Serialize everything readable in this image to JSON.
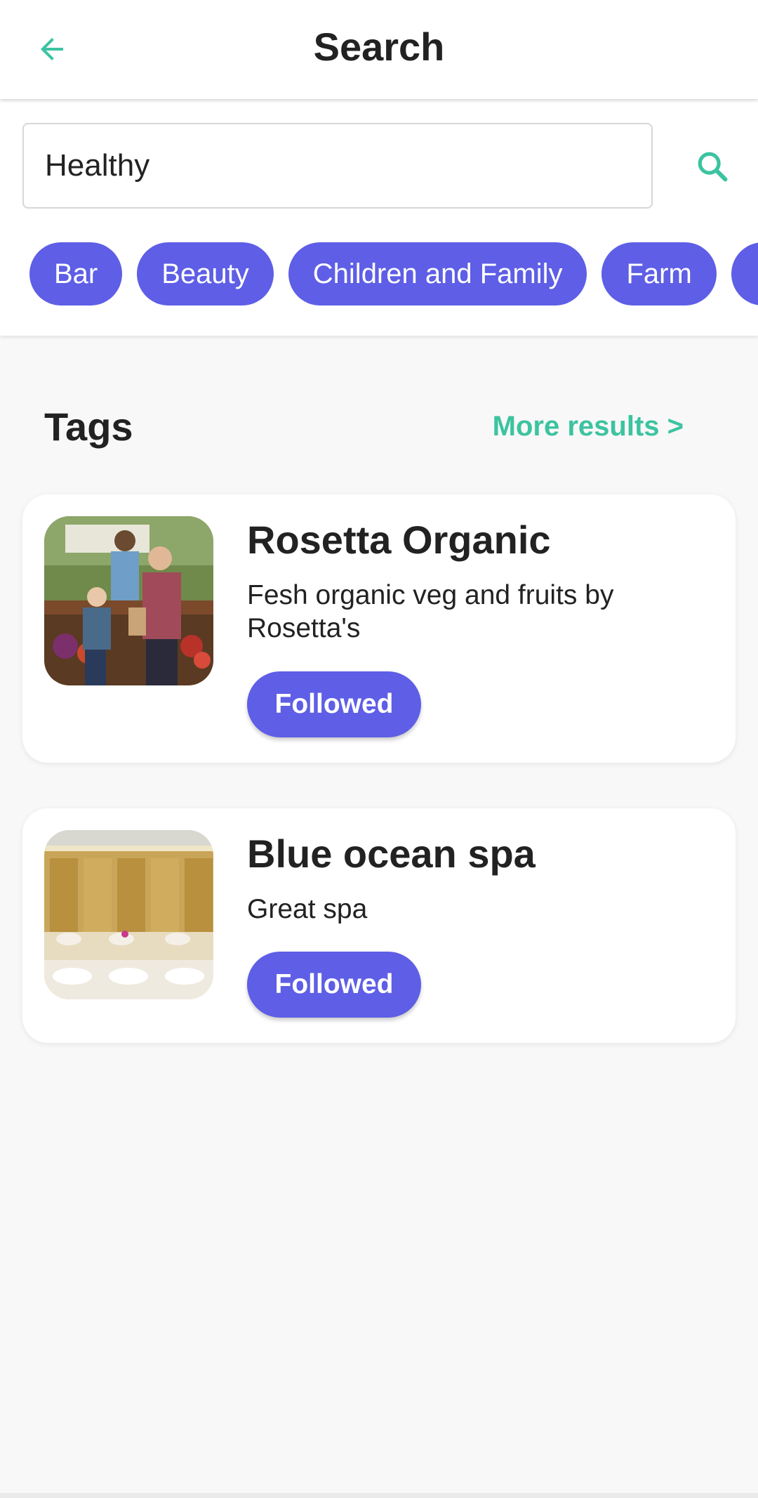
{
  "header": {
    "title": "Search",
    "back_icon": "arrow-left-icon",
    "accent_color": "#3cc3a0"
  },
  "search": {
    "value": "Healthy",
    "icon": "search-icon"
  },
  "categories": [
    "Bar",
    "Beauty",
    "Children and Family",
    "Farm",
    "F"
  ],
  "chip_color": "#5e5ee6",
  "tags_section": {
    "title": "Tags",
    "more_label": "More results >"
  },
  "results": [
    {
      "title": "Rosetta Organic",
      "description": "Fesh organic veg and fruits by Rosetta's",
      "button_label": "Followed",
      "image": "farmers-market-photo"
    },
    {
      "title": "Blue ocean spa",
      "description": "Great spa",
      "button_label": "Followed",
      "image": "spa-interior-photo"
    }
  ]
}
